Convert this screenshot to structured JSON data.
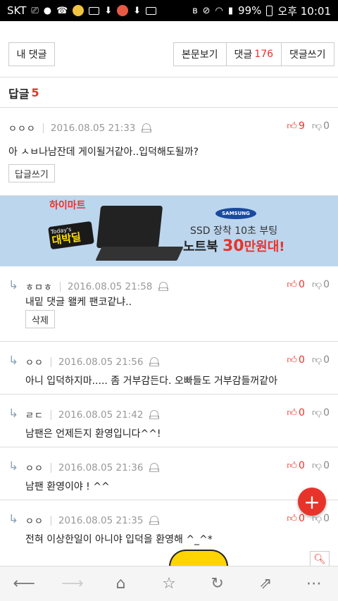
{
  "status_bar": {
    "carrier": "SKT",
    "battery": "99%",
    "time": "오후 10:01"
  },
  "top_nav": {
    "my_comments": "내 댓글",
    "view_article": "본문보기",
    "comments_label": "댓글",
    "comments_count": "176",
    "write_comment": "댓글쓰기"
  },
  "reply_header": {
    "label": "답글",
    "count": "5"
  },
  "main_comment": {
    "author": "ㅇㅇㅇ",
    "date": "2016.08.05 21:33",
    "up": "9",
    "down": "0",
    "text": "아 ㅅㅂ나남잔데 게이될거같아..입덕해도될까?",
    "reply_button": "답글쓰기"
  },
  "ad": {
    "brand": "하이마트",
    "badge_top": "Today's",
    "badge_main": "대박딜",
    "maker": "SAMSUNG",
    "line1": "SSD 장착 10초 부팅",
    "line2_prefix": "노트북 ",
    "line2_price": "30",
    "line2_suffix": "만원대!"
  },
  "replies": [
    {
      "author": "ㅎㅁㅎ",
      "date": "2016.08.05 21:58",
      "up": "0",
      "down": "0",
      "text": "내밑 댓글 왤케 팬코같냐..",
      "delete_button": "삭제"
    },
    {
      "author": "ㅇㅇ",
      "date": "2016.08.05 21:56",
      "up": "0",
      "down": "0",
      "text": "아니 입덕하지마..... 좀 거부감든다. 오빠들도 거부감들꺼같아"
    },
    {
      "author": "ㄹㄷ",
      "date": "2016.08.05 21:42",
      "up": "0",
      "down": "0",
      "text": "남팬은 언제든지 환영입니다^^!"
    },
    {
      "author": "ㅇㅇ",
      "date": "2016.08.05 21:36",
      "up": "0",
      "down": "0",
      "text": "남팬 환영이야 ! ^^"
    },
    {
      "author": "ㅇㅇ",
      "date": "2016.08.05 21:35",
      "up": "0",
      "down": "0",
      "text": "전혀 이상한일이 아니야 입덕을 환영해 ^_^*"
    }
  ],
  "icons": {
    "fab": "plus-icon",
    "search": "search-icon"
  }
}
